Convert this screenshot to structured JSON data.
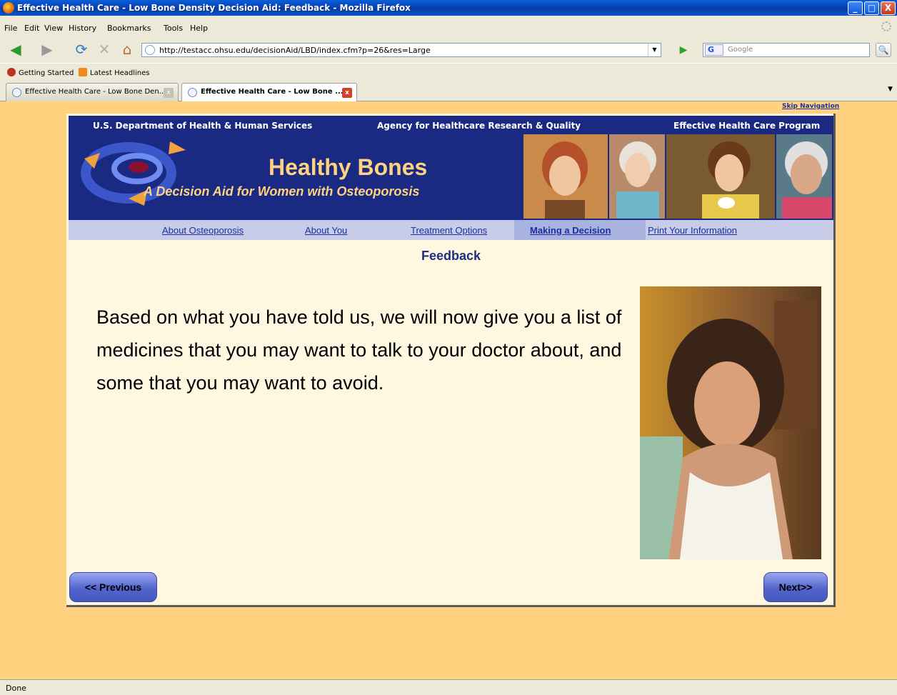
{
  "window": {
    "title": "Effective Health Care - Low Bone Density Decision Aid: Feedback - Mozilla Firefox",
    "min": "_",
    "max": "□",
    "close": "X"
  },
  "menu": [
    "File",
    "Edit",
    "View",
    "History",
    "Bookmarks",
    "Tools",
    "Help"
  ],
  "toolbar": {
    "back": "◀",
    "forward": "▶",
    "reload": "⟳",
    "stop": "✕",
    "home": "⌂",
    "url": "http://testacc.ohsu.edu/decisionAid/LBD/index.cfm?p=26&res=Large",
    "go": "▶",
    "search_engine": "G",
    "search_placeholder": "Google",
    "search_btn": "🔍"
  },
  "bookmarks": [
    "Getting Started",
    "Latest Headlines"
  ],
  "tabs": [
    {
      "label": "Effective Health Care - Low Bone Den...",
      "active": false
    },
    {
      "label": "Effective Health Care - Low Bone ...",
      "active": true
    }
  ],
  "page": {
    "skip_nav": "Skip Navigation",
    "agencies": [
      "U.S. Department of Health & Human Services",
      "Agency for Healthcare Research & Quality",
      "Effective Health Care Program"
    ],
    "brand_title": "Healthy Bones",
    "brand_subtitle": "A Decision Aid for Women with Osteoporosis",
    "nav": [
      "About Osteoporosis",
      "About You",
      "Treatment Options",
      "Making a Decision",
      "Print Your Information"
    ],
    "nav_active": "Making a Decision",
    "title": "Feedback",
    "body": "Based on what you have told us, we will now give you a list of medicines that you may want to talk to your doctor about, and some that you may want to avoid.",
    "prev_label": "<< Previous",
    "next_label": "Next>>"
  },
  "colors": {
    "banner": "#1A2A83",
    "page_bg": "#FFD27F",
    "content_bg": "#FFF7E0",
    "nav_strip": "#C8CCE8",
    "link": "#1C2F9C"
  },
  "status": "Done"
}
